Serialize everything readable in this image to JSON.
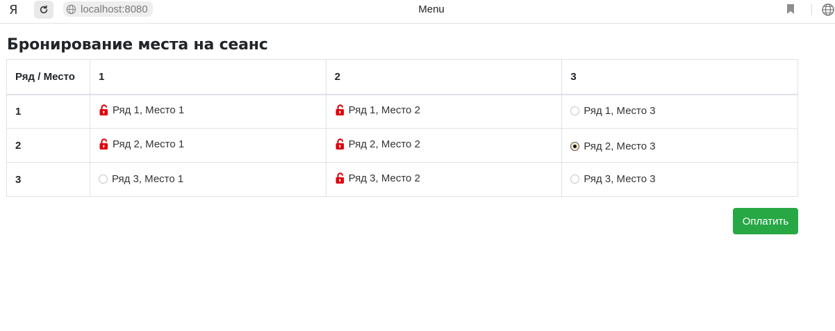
{
  "browser": {
    "logo": "Я",
    "address": "localhost:8080",
    "tab_title": "Menu"
  },
  "page": {
    "title": "Бронирование места на сеанс"
  },
  "table": {
    "headers": [
      "Ряд / Место",
      "1",
      "2",
      "3"
    ],
    "rows": [
      {
        "row_label": "1",
        "seats": [
          {
            "label": "Ряд 1, Место 1",
            "state": "occupied",
            "icon": "lock-open-icon"
          },
          {
            "label": "Ряд 1, Место 2",
            "state": "occupied",
            "icon": "lock-open-icon"
          },
          {
            "label": "Ряд 1, Место 3",
            "state": "free",
            "checked": false
          }
        ]
      },
      {
        "row_label": "2",
        "seats": [
          {
            "label": "Ряд 2, Место 1",
            "state": "occupied",
            "icon": "lock-open-icon"
          },
          {
            "label": "Ряд 2, Место 2",
            "state": "occupied",
            "icon": "lock-open-icon"
          },
          {
            "label": "Ряд 2, Место 3",
            "state": "free",
            "checked": true
          }
        ]
      },
      {
        "row_label": "3",
        "seats": [
          {
            "label": "Ряд 3, Место 1",
            "state": "free",
            "checked": false
          },
          {
            "label": "Ряд 3, Место 2",
            "state": "occupied",
            "icon": "lock-open-icon"
          },
          {
            "label": "Ряд 3, Место 3",
            "state": "free",
            "checked": false
          }
        ]
      }
    ]
  },
  "actions": {
    "pay_label": "Оплатить"
  },
  "colors": {
    "pay_button": "#28a745",
    "lock_icon": "#e0000b",
    "table_border": "#dee2e6"
  }
}
